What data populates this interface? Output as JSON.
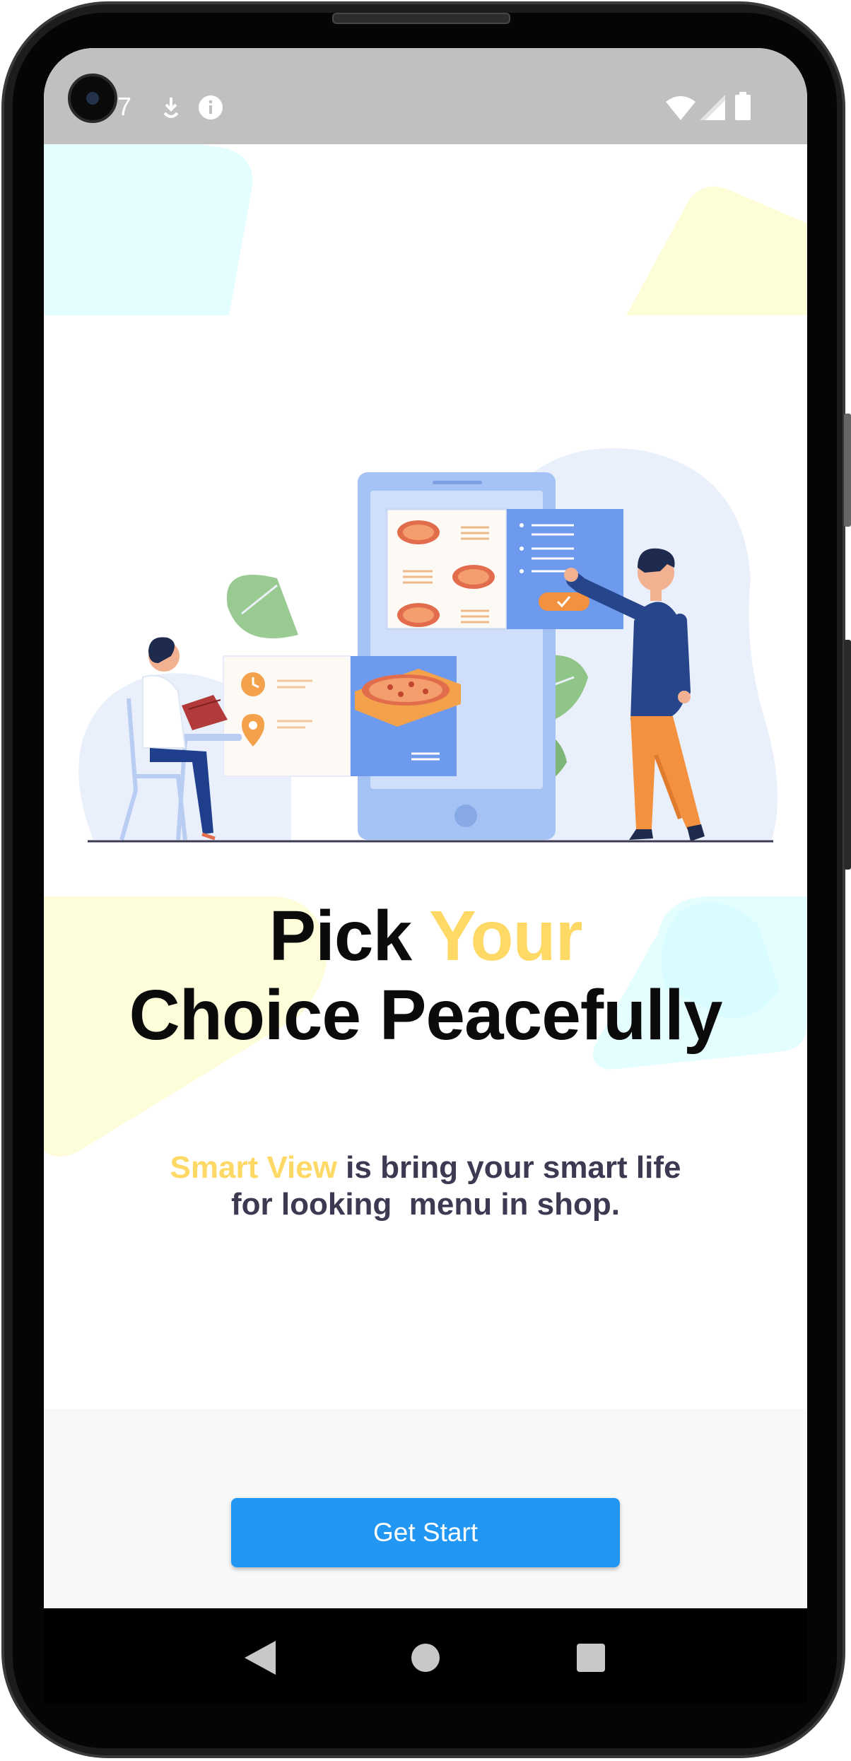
{
  "status_bar": {
    "time_fragment": "7",
    "icons": [
      "download-icon",
      "info-icon",
      "wifi-icon",
      "signal-icon",
      "battery-icon"
    ]
  },
  "onboarding": {
    "headline_line1_part1": "Pick ",
    "headline_line1_accent": "Your",
    "headline_line2": "Choice Peacefully",
    "subtitle_accent": "Smart View",
    "subtitle_line1_rest": " is bring your smart life",
    "subtitle_line2": "for looking  menu in shop.",
    "cta_label": "Get Start"
  },
  "navigation": {
    "buttons": [
      "back-icon",
      "home-icon",
      "recents-icon"
    ]
  },
  "colors": {
    "accent_yellow": "#ffd966",
    "primary_blue": "#2196f3",
    "text_dark": "#0b0b0b",
    "subtitle_text": "#3b3a52",
    "status_bar_bg": "#c0c0c0"
  }
}
